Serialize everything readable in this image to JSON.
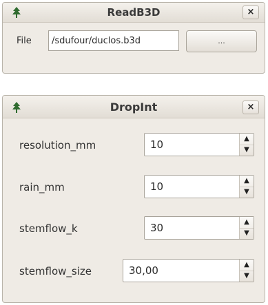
{
  "read_window": {
    "title": "ReadB3D",
    "close_label": "×",
    "file_label": "File",
    "file_value": "/sdufour/duclos.b3d",
    "browse_label": "..."
  },
  "drop_window": {
    "title": "DropInt",
    "close_label": "×",
    "fields": [
      {
        "label": "resolution_mm",
        "value": "10"
      },
      {
        "label": "rain_mm",
        "value": "10"
      },
      {
        "label": "stemflow_k",
        "value": "30"
      },
      {
        "label": "stemflow_size",
        "value": "30,00"
      }
    ]
  },
  "icons": {
    "app": "tree-icon",
    "close": "close-icon",
    "spin_up": "arrow-up-icon",
    "spin_down": "arrow-down-icon"
  }
}
